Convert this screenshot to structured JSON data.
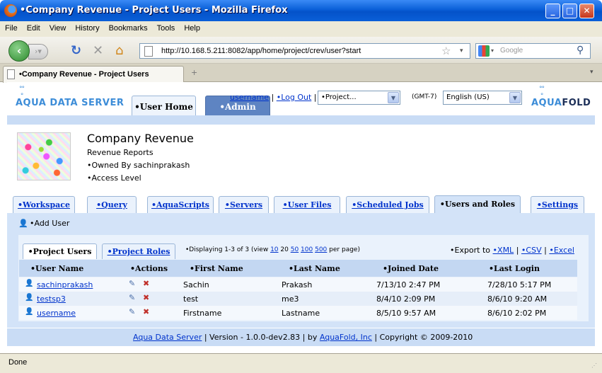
{
  "window": {
    "title": "•Company Revenue - Project Users - Mozilla Firefox"
  },
  "menu": [
    "File",
    "Edit",
    "View",
    "History",
    "Bookmarks",
    "Tools",
    "Help"
  ],
  "nav": {
    "url": "http://10.168.5.211:8082/app/home/project/crev/user?start",
    "search_placeholder": "Google"
  },
  "browser_tab": {
    "label": "•Company Revenue - Project Users",
    "new_tab": "+"
  },
  "header": {
    "brand_left": "AQUA DATA SERVER",
    "brand_right_a": "AQUA",
    "brand_right_b": "FOLD",
    "tab_user_home": "•User Home",
    "tab_admin": "•Admin",
    "user_link": "username",
    "sep1": "|",
    "logout": "•Log Out",
    "sep2": "|",
    "project_select": "•Project...",
    "timezone": "(GMT-7)",
    "language_select": "English (US)"
  },
  "project": {
    "name": "Company Revenue",
    "description": "Revenue Reports",
    "owner": "•Owned By sachinprakash",
    "access": "•Access Level"
  },
  "nav_tabs": [
    "•Workspace",
    "•Query",
    "•AquaScripts",
    "•Servers",
    "•User Files",
    "•Scheduled Jobs",
    "•Users and Roles",
    "•Settings"
  ],
  "actions": {
    "add_user": "•Add User"
  },
  "inner_tabs": {
    "project_users": "•Project Users",
    "project_roles": "•Project Roles"
  },
  "paging": {
    "prefix": "•Displaying 1-3 of 3 (view",
    "opt10": "10",
    "opt20": "20",
    "opt50": "50",
    "opt100": "100",
    "opt500": "500",
    "suffix": "per page)"
  },
  "export": {
    "label": "•Export to",
    "xml": "•XML",
    "sep": "|",
    "csv": "•CSV",
    "sep2": "|",
    "excel": "•Excel"
  },
  "table": {
    "headers": [
      "•User Name",
      "•Actions",
      "•First Name",
      "•Last Name",
      "•Joined Date",
      "•Last Login"
    ],
    "rows": [
      {
        "user": "sachinprakash",
        "first": "Sachin",
        "last": "Prakash",
        "joined": "7/13/10 2:47 PM",
        "login": "7/28/10 5:17 PM"
      },
      {
        "user": "testsp3",
        "first": "test",
        "last": "me3",
        "joined": "8/4/10 2:09 PM",
        "login": "8/6/10 9:20 AM"
      },
      {
        "user": "username",
        "first": "Firstname",
        "last": "Lastname",
        "joined": "8/5/10 9:57 AM",
        "login": "8/6/10 2:02 PM"
      }
    ]
  },
  "footer": {
    "product": "Aqua Data Server",
    "version": "| Version - 1.0.0-dev2.83 | by",
    "company": "AquaFold, Inc",
    "copyright": "| Copyright © 2009-2010"
  },
  "status": {
    "text": "Done"
  },
  "colors": {
    "titlebar": "#0a5fd8",
    "accent_band": "#c9dcf5",
    "link": "#0033cc"
  }
}
